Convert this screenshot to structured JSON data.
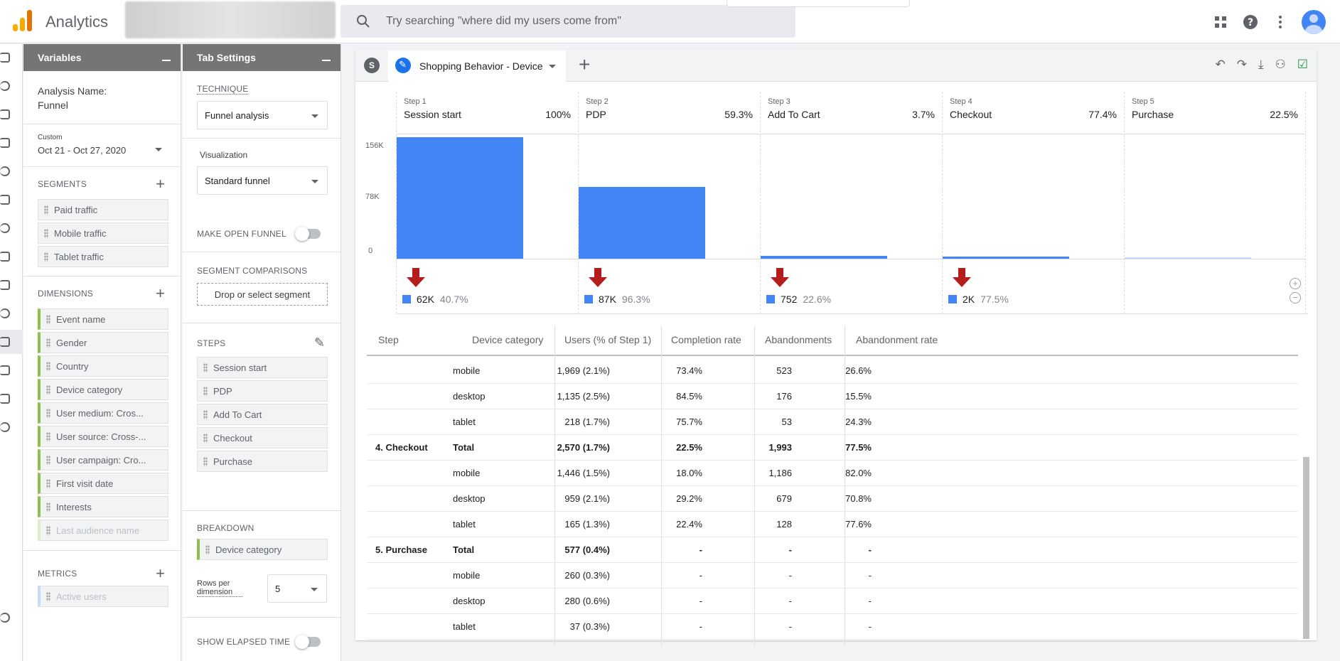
{
  "app": {
    "title": "Analytics",
    "search_placeholder": "Try searching \"where did my users come from\"",
    "accent": "#4285f4"
  },
  "top_icons": [
    "apps-grid-icon",
    "help-icon",
    "more-vert-icon",
    "account-avatar"
  ],
  "variables": {
    "header": "Variables",
    "analysis_label": "Analysis Name:",
    "analysis_name": "Funnel",
    "date_label": "Custom",
    "date_range": "Oct 21 - Oct 27, 2020",
    "segments_title": "SEGMENTS",
    "segments": [
      "Paid traffic",
      "Mobile traffic",
      "Tablet traffic"
    ],
    "dimensions_title": "DIMENSIONS",
    "dimensions": [
      "Event name",
      "Gender",
      "Country",
      "Device category",
      "User medium: Cros...",
      "User source: Cross-...",
      "User campaign: Cro...",
      "First visit date",
      "Interests"
    ],
    "dimension_faded": "Last audience name",
    "metrics_title": "METRICS",
    "metric_faded": "Active users"
  },
  "tab_settings": {
    "header": "Tab Settings",
    "technique_title": "TECHNIQUE",
    "technique": "Funnel analysis",
    "visualization_label": "Visualization",
    "visualization": "Standard funnel",
    "open_funnel_label": "MAKE OPEN FUNNEL",
    "segment_comparisons_title": "SEGMENT COMPARISONS",
    "segment_drop": "Drop or select segment",
    "steps_title": "STEPS",
    "steps": [
      "Session start",
      "PDP",
      "Add To Cart",
      "Checkout",
      "Purchase"
    ],
    "breakdown_title": "BREAKDOWN",
    "breakdown": "Device category",
    "rows_per_dimension_label": "Rows per dimension",
    "rows_per_dimension": "5",
    "elapsed_time_label": "SHOW ELAPSED TIME"
  },
  "main": {
    "segment_badge": "S",
    "tab_label": "Shopping Behavior - Device",
    "add_tab": "+",
    "tool_icons": [
      "undo-icon",
      "redo-icon",
      "download-icon",
      "share-icon",
      "export-check-icon"
    ]
  },
  "chart_data": {
    "type": "bar",
    "categories": [
      "Session start",
      "PDP",
      "Add To Cart",
      "Checkout",
      "Purchase"
    ],
    "step_labels": [
      "Step 1",
      "Step 2",
      "Step 3",
      "Step 4",
      "Step 5"
    ],
    "step_pcts": [
      "100%",
      "59.3%",
      "3.7%",
      "77.4%",
      "22.5%"
    ],
    "values": [
      152000,
      90000,
      3330,
      2570,
      577
    ],
    "yticks": [
      "156K",
      "78K",
      "0"
    ],
    "ylim": [
      0,
      156000
    ],
    "drops": [
      {
        "value": "62K",
        "pct": "40.7%"
      },
      {
        "value": "87K",
        "pct": "96.3%"
      },
      {
        "value": "752",
        "pct": "22.6%"
      },
      {
        "value": "2K",
        "pct": "77.5%"
      }
    ]
  },
  "table": {
    "headers": [
      "Step",
      "Device category",
      "Users (% of Step 1)",
      "Completion rate",
      "Abandonments",
      "Abandonment rate"
    ],
    "rows": [
      {
        "step": "",
        "device": "mobile",
        "users": "1,969 (2.1%)",
        "completion": "73.4%",
        "abandon": "523",
        "abandon_rate": "26.6%",
        "bold": false
      },
      {
        "step": "",
        "device": "desktop",
        "users": "1,135 (2.5%)",
        "completion": "84.5%",
        "abandon": "176",
        "abandon_rate": "15.5%",
        "bold": false
      },
      {
        "step": "",
        "device": "tablet",
        "users": "218 (1.7%)",
        "completion": "75.7%",
        "abandon": "53",
        "abandon_rate": "24.3%",
        "bold": false
      },
      {
        "step": "4. Checkout",
        "device": "Total",
        "users": "2,570 (1.7%)",
        "completion": "22.5%",
        "abandon": "1,993",
        "abandon_rate": "77.5%",
        "bold": true
      },
      {
        "step": "",
        "device": "mobile",
        "users": "1,446 (1.5%)",
        "completion": "18.0%",
        "abandon": "1,186",
        "abandon_rate": "82.0%",
        "bold": false
      },
      {
        "step": "",
        "device": "desktop",
        "users": "959 (2.1%)",
        "completion": "29.2%",
        "abandon": "679",
        "abandon_rate": "70.8%",
        "bold": false
      },
      {
        "step": "",
        "device": "tablet",
        "users": "165 (1.3%)",
        "completion": "22.4%",
        "abandon": "128",
        "abandon_rate": "77.6%",
        "bold": false
      },
      {
        "step": "5. Purchase",
        "device": "Total",
        "users": "577 (0.4%)",
        "completion": "-",
        "abandon": "-",
        "abandon_rate": "-",
        "bold": true
      },
      {
        "step": "",
        "device": "mobile",
        "users": "260 (0.3%)",
        "completion": "-",
        "abandon": "-",
        "abandon_rate": "-",
        "bold": false
      },
      {
        "step": "",
        "device": "desktop",
        "users": "280 (0.6%)",
        "completion": "-",
        "abandon": "-",
        "abandon_rate": "-",
        "bold": false
      },
      {
        "step": "",
        "device": "tablet",
        "users": "37 (0.3%)",
        "completion": "-",
        "abandon": "-",
        "abandon_rate": "-",
        "bold": false
      }
    ]
  }
}
